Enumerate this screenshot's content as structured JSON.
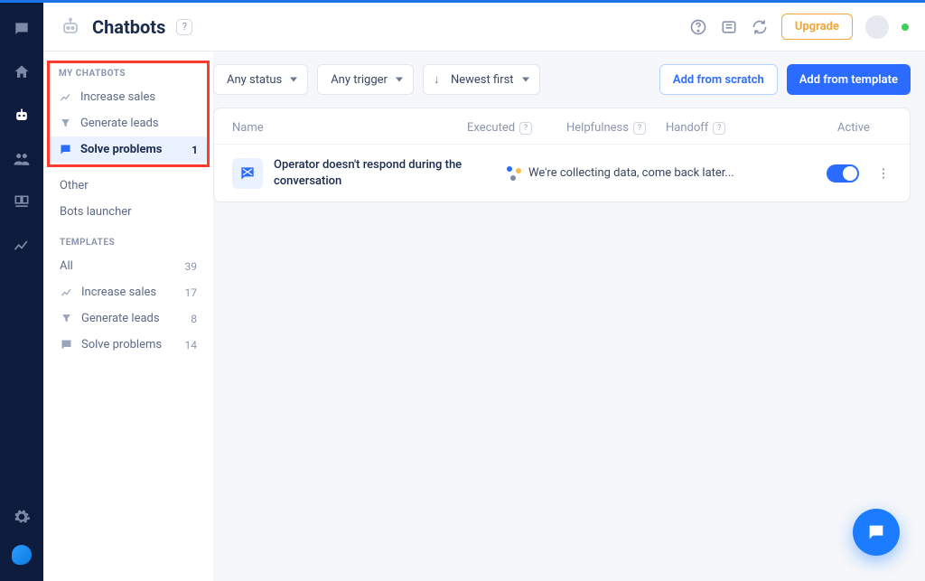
{
  "header": {
    "title": "Chatbots",
    "upgrade_label": "Upgrade"
  },
  "sidebar": {
    "my_chatbots_header": "MY CHATBOTS",
    "templates_header": "TEMPLATES",
    "my": {
      "increase": "Increase sales",
      "generate": "Generate leads",
      "solve": "Solve problems",
      "solve_count": "1",
      "other": "Other",
      "bots_launcher": "Bots launcher"
    },
    "tpl": {
      "all": "All",
      "all_count": "39",
      "increase": "Increase sales",
      "increase_count": "17",
      "generate": "Generate leads",
      "generate_count": "8",
      "solve": "Solve problems",
      "solve_count": "14"
    }
  },
  "toolbar": {
    "status": "Any status",
    "trigger": "Any trigger",
    "sort": "Newest first",
    "add_scratch": "Add from scratch",
    "add_template": "Add from template"
  },
  "table": {
    "col_name": "Name",
    "col_executed": "Executed",
    "col_helpfulness": "Helpfulness",
    "col_handoff": "Handoff",
    "col_active": "Active"
  },
  "row": {
    "name": "Operator doesn't respond during the conversation",
    "collecting": "We're collecting data, come back later..."
  }
}
